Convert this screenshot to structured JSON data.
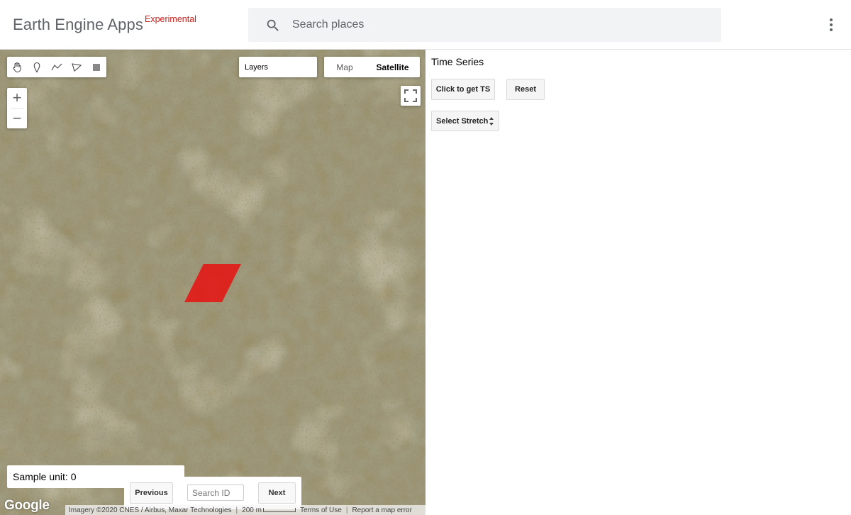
{
  "header": {
    "app_title": "Earth Engine Apps",
    "badge": "Experimental",
    "search_placeholder": "Search places",
    "search_value": "",
    "icons": {
      "search": "search-icon",
      "more": "more-vert-icon"
    }
  },
  "map": {
    "draw_tools": [
      "hand-icon",
      "marker-icon",
      "line-icon",
      "polygon-icon",
      "rectangle-icon"
    ],
    "zoom_in": "+",
    "zoom_out": "−",
    "layers_label": "Layers",
    "map_type": {
      "map": "Map",
      "satellite": "Satellite",
      "selected": "Satellite"
    },
    "sample_unit": "Sample unit: 0",
    "nav": {
      "previous": "Previous",
      "search_placeholder": "Search ID",
      "next": "Next"
    },
    "logo": "Google",
    "attribution": {
      "imagery": "Imagery ©2020 CNES / Airbus, Maxar Technologies",
      "scale": "200 m",
      "terms": "Terms of Use",
      "report": "Report a map error"
    },
    "highlight_color": "#e81010"
  },
  "panel": {
    "title": "Time Series",
    "get_ts_button": "Click to get TS",
    "reset_button": "Reset",
    "stretch_select": "Select Stretch"
  }
}
